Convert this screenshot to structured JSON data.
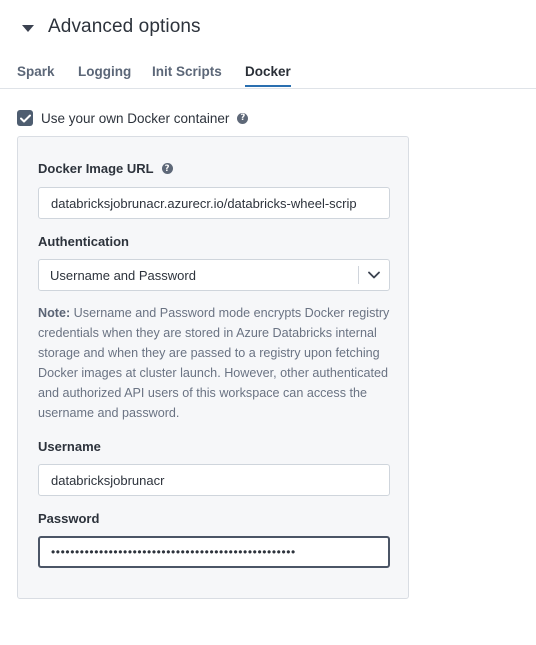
{
  "section": {
    "title": "Advanced options"
  },
  "tabs": [
    {
      "label": "Spark"
    },
    {
      "label": "Logging"
    },
    {
      "label": "Init Scripts"
    },
    {
      "label": "Docker"
    }
  ],
  "docker": {
    "use_own_container_label": "Use your own Docker container",
    "use_own_container_checked": true,
    "image_url_label": "Docker Image URL",
    "image_url_value": "databricksjobrunacr.azurecr.io/databricks-wheel-scrip",
    "auth_label": "Authentication",
    "auth_value": "Username and Password",
    "note_prefix": "Note:",
    "note_text": " Username and Password mode encrypts Docker registry credentials when they are stored in Azure Databricks internal storage and when they are passed to a registry upon fetching Docker images at cluster launch. However, other authenticated and authorized API users of this workspace can access the username and password.",
    "username_label": "Username",
    "username_value": "databricksjobrunacr",
    "password_label": "Password",
    "password_value": "•••••••••••••••••••••••••••••••••••••••••••••••••••"
  }
}
